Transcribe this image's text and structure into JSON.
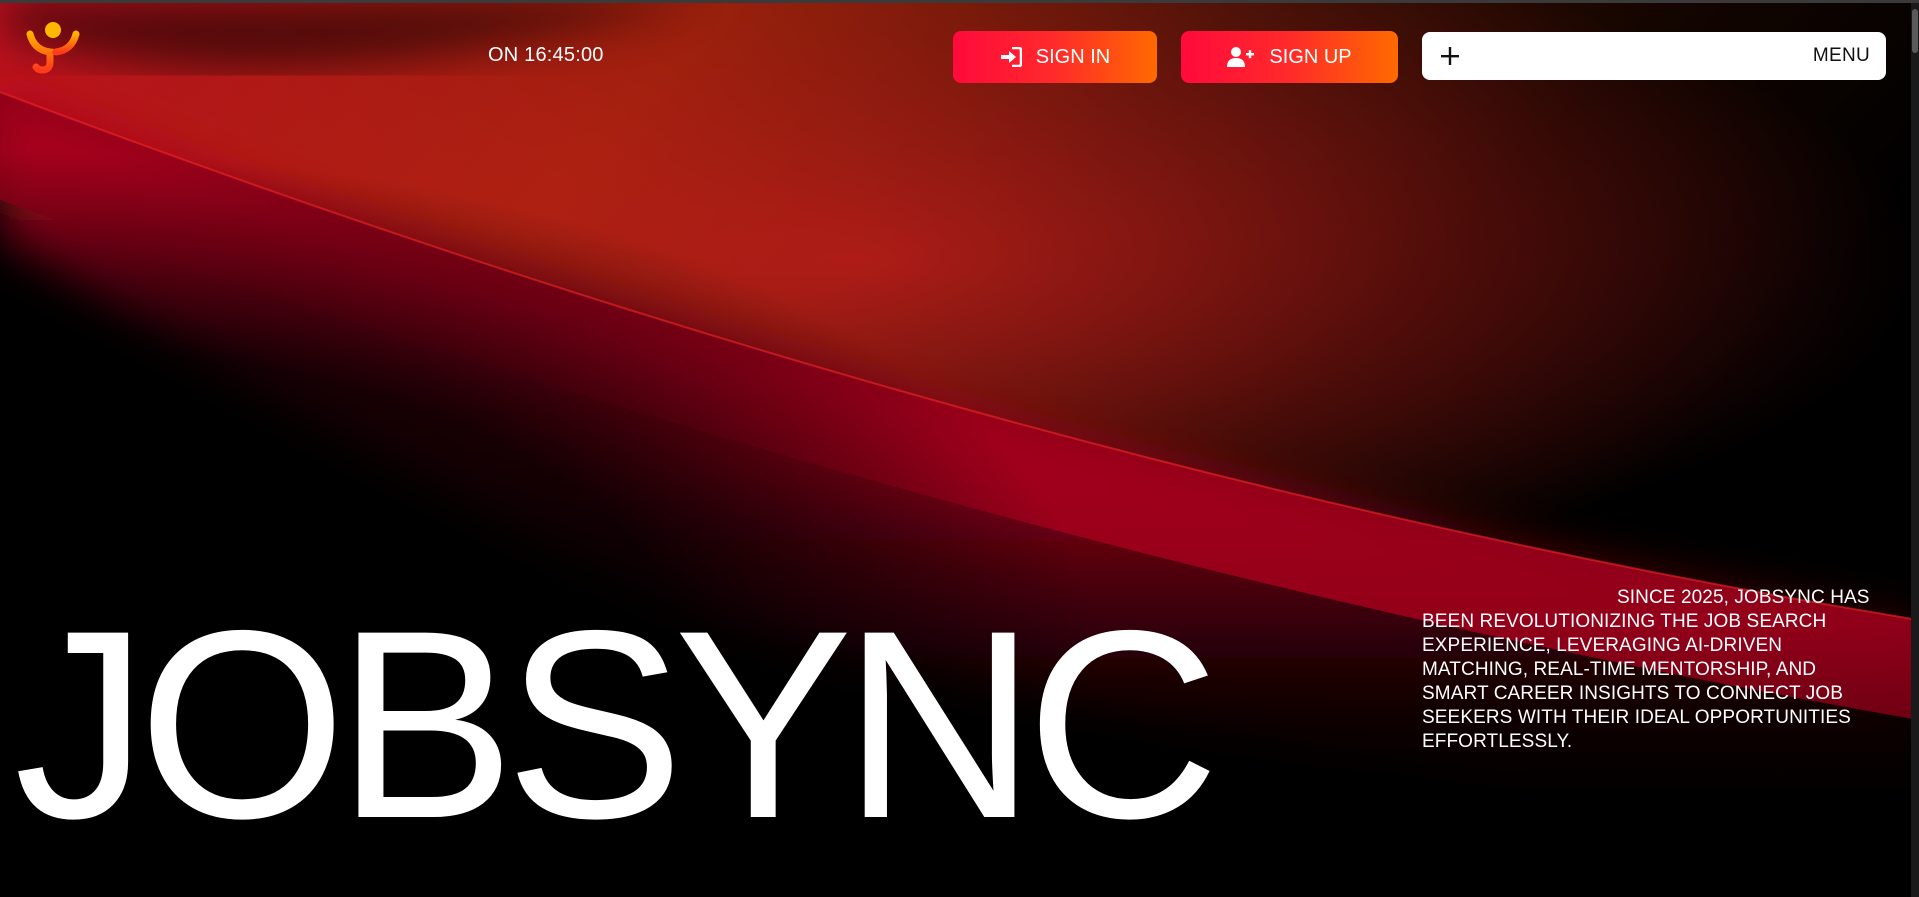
{
  "header": {
    "clock": "ON 16:45:00",
    "sign_in_label": "SIGN IN",
    "sign_up_label": "SIGN UP",
    "menu_label": "MENU"
  },
  "hero": {
    "brand": "JOBSYNC",
    "about": "SINCE 2025, JOBSYNC HAS BEEN REVOLUTIONIZING THE JOB SEARCH EXPERIENCE, LEVERAGING AI-DRIVEN MATCHING, REAL-TIME MENTORSHIP, AND SMART CAREER INSIGHTS TO CONNECT JOB SEEKERS WITH THEIR IDEAL OPPORTUNITIES EFFORTLESSLY."
  },
  "icons": {
    "logo": "jobsync-logo-icon",
    "sign_in": "sign-in-icon",
    "sign_up": "user-plus-icon",
    "menu": "plus-icon"
  },
  "colors": {
    "background": "#000000",
    "accent_red": "#ff0a3c",
    "accent_orange": "#ff6a00",
    "crimson": "#a8001e",
    "text": "#ffffff",
    "menu_bar": "#ffffff"
  }
}
